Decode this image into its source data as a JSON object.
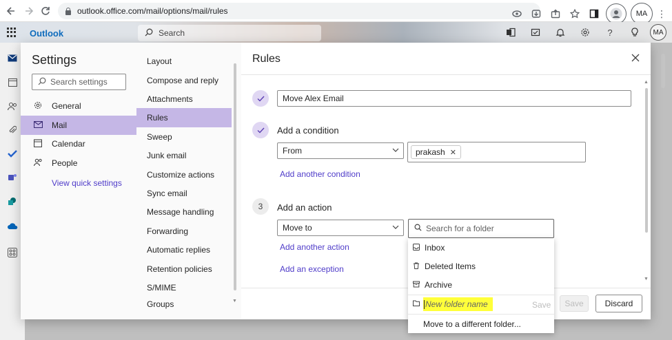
{
  "browser": {
    "url": "outlook.office.com/mail/options/mail/rules",
    "profile_initials": "MA",
    "icons": [
      "back-icon",
      "forward-icon",
      "reload-icon",
      "lock-icon",
      "eye-icon",
      "install-icon",
      "share-icon",
      "star-icon",
      "sidepanel-icon",
      "profile-icon",
      "menu-icon"
    ]
  },
  "outlook_bar": {
    "brand": "Outlook",
    "search_placeholder": "Search",
    "avatar_initials": "MA"
  },
  "settings": {
    "title": "Settings",
    "search_placeholder": "Search settings",
    "categories": [
      {
        "label": "General",
        "icon": "gear-icon"
      },
      {
        "label": "Mail",
        "icon": "mail-icon",
        "active": true
      },
      {
        "label": "Calendar",
        "icon": "calendar-icon"
      },
      {
        "label": "People",
        "icon": "people-icon"
      }
    ],
    "view_quick_settings": "View quick settings"
  },
  "mail_subsections": [
    "Layout",
    "Compose and reply",
    "Attachments",
    "Rules",
    "Sweep",
    "Junk email",
    "Customize actions",
    "Sync email",
    "Message handling",
    "Forwarding",
    "Automatic replies",
    "Retention policies",
    "S/MIME",
    "Groups"
  ],
  "active_subsection": "Rules",
  "rules": {
    "title": "Rules",
    "rule_name": "Move Alex Email",
    "condition_heading": "Add a condition",
    "condition_type": "From",
    "condition_chip": "prakash",
    "add_another_condition": "Add another condition",
    "action_step_number": "3",
    "action_heading": "Add an action",
    "action_type": "Move to",
    "add_another_action": "Add another action",
    "add_exception": "Add an exception",
    "save_button": "Save",
    "discard_button": "Discard"
  },
  "folder_picker": {
    "search_placeholder": "Search for a folder",
    "folders": [
      "Inbox",
      "Deleted Items",
      "Archive"
    ],
    "new_folder_placeholder": "New folder name",
    "save_label": "Save",
    "move_different": "Move to a different folder..."
  },
  "colors": {
    "accent": "#c5b7e6",
    "link": "#4f3cc9",
    "highlight": "#ffff3a"
  }
}
